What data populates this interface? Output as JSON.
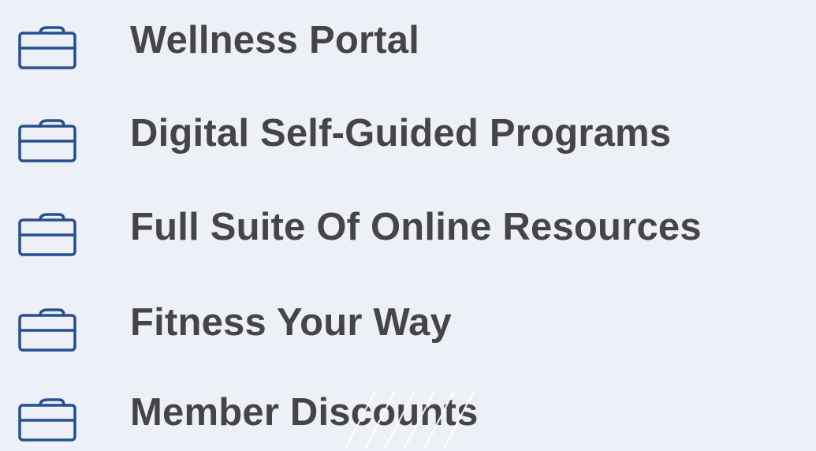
{
  "list": {
    "accent": "#25508f",
    "text_color": "#454545",
    "background": "#eef0f7",
    "items": [
      {
        "icon": "briefcase-icon",
        "label": "Wellness Portal"
      },
      {
        "icon": "briefcase-icon",
        "label": "Digital Self-Guided Programs"
      },
      {
        "icon": "briefcase-icon",
        "label": "Full Suite Of Online Resources"
      },
      {
        "icon": "briefcase-icon",
        "label": "Fitness Your Way"
      },
      {
        "icon": "briefcase-icon",
        "label": "Member Discounts"
      }
    ]
  }
}
